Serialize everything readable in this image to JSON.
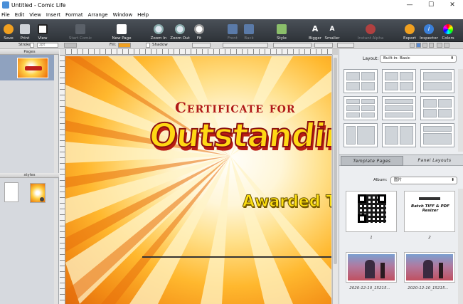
{
  "window": {
    "title": "Untitled - Comic Life",
    "minimize": "—",
    "maximize": "☐",
    "close": "✕"
  },
  "menu": [
    "File",
    "Edit",
    "View",
    "Insert",
    "Format",
    "Arrange",
    "Window",
    "Help"
  ],
  "toolbar": {
    "save": "Save",
    "print": "Print",
    "view": "View",
    "start_comic": "Start Comic",
    "new_page": "New Page",
    "zoom_in": "Zoom In",
    "zoom_out": "Zoom Out",
    "fit": "Fit",
    "front": "Front",
    "back": "Back",
    "style": "Style",
    "bigger": "Bigger",
    "smaller": "Smaller",
    "instant_alpha": "Instant Alpha",
    "export": "Export",
    "inspector": "Inspector",
    "colors": "Colors"
  },
  "format_bar": {
    "stroke_label": "Stroke:",
    "stroke_value": "2pt",
    "fill_label": "Fill:",
    "shadow_label": "Shadow"
  },
  "left_panel": {
    "pages_header": "Pages",
    "styles_header": "styles"
  },
  "certificate": {
    "line1": "Certificate for",
    "line2": "Outstanding E",
    "line3": "Awarded To"
  },
  "right_panel": {
    "layout_label": "Layout:",
    "layout_value": "Built-in: Basic",
    "tab_template_pages": "Template Pages",
    "tab_panel_layouts": "Panel Layouts",
    "album_label": "Album:",
    "album_value": "图片",
    "items": [
      {
        "caption": "1",
        "kind": "qr"
      },
      {
        "caption": "2",
        "kind": "doc",
        "doc_text": "Batch TIFF & PDF Resizer"
      },
      {
        "caption": "2020-12-10_15215...",
        "kind": "photo"
      },
      {
        "caption": "2020-12-10_15215...",
        "kind": "photo"
      }
    ]
  },
  "colors": {
    "toolbar_bg": "#3a3f45",
    "accent": "#f0a020",
    "cert_red": "#b01818",
    "cert_yellow": "#ffe010"
  }
}
